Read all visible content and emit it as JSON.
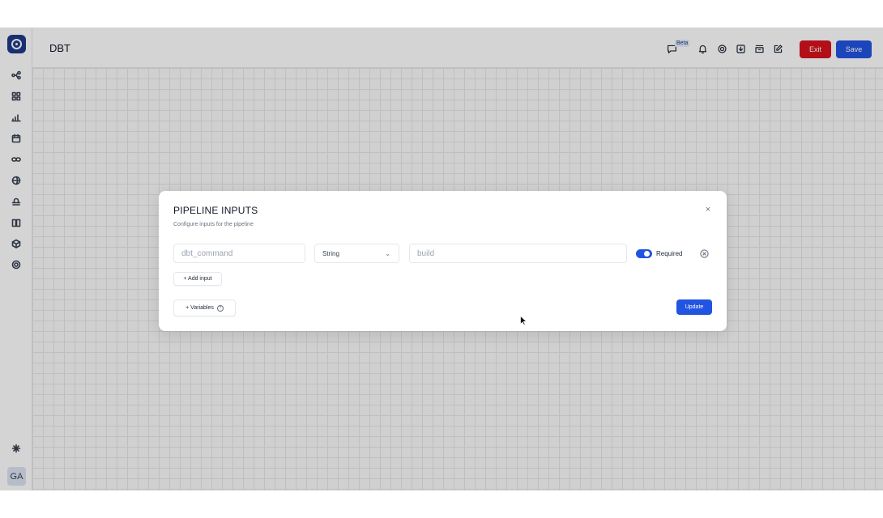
{
  "header": {
    "title": "DBT",
    "beta_label": "Beta",
    "exit_label": "Exit",
    "save_label": "Save",
    "icons": [
      "chat-icon",
      "bell-icon",
      "gear-icon",
      "download-icon",
      "archive-icon",
      "edit-icon"
    ]
  },
  "sidebar": {
    "items": [
      {
        "icon": "pipeline-icon"
      },
      {
        "icon": "grid-icon"
      },
      {
        "icon": "chart-icon"
      },
      {
        "icon": "calendar-icon"
      },
      {
        "icon": "link-icon"
      },
      {
        "icon": "globe-icon"
      },
      {
        "icon": "terminal-icon"
      },
      {
        "icon": "book-icon"
      },
      {
        "icon": "cube-icon"
      },
      {
        "icon": "settings-icon"
      }
    ],
    "bottom_icon": "sparkle-icon",
    "avatar_initials": "GA"
  },
  "modal": {
    "title": "PIPELINE INPUTS",
    "subtitle": "Configure inputs for the pipeline",
    "close_symbol": "×",
    "input_row": {
      "name_placeholder": "dbt_command",
      "type_value": "String",
      "value_placeholder": "build",
      "required": true,
      "required_label": "Required"
    },
    "add_input_label": "+ Add input",
    "variables_label": "+ Variables",
    "update_label": "Update"
  },
  "colors": {
    "primary": "#2154e0",
    "danger": "#d7131e",
    "logo": "#1e3a8a"
  }
}
